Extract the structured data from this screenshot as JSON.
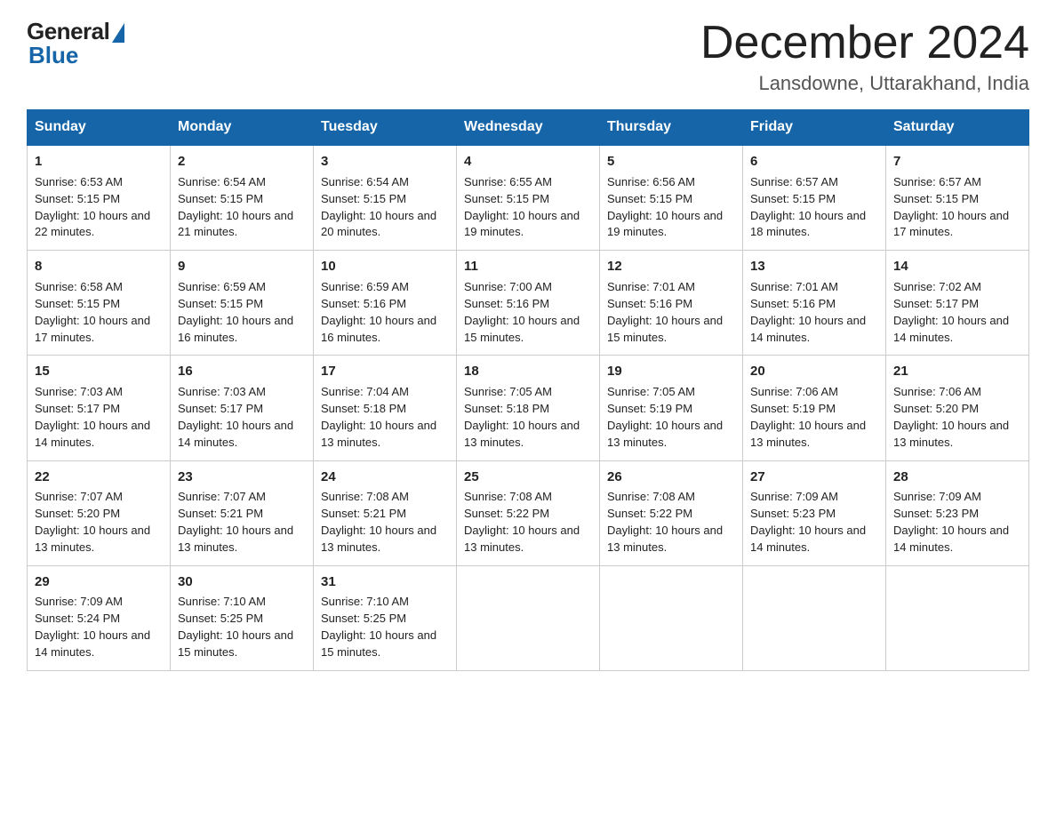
{
  "logo": {
    "general": "General",
    "blue": "Blue"
  },
  "title": "December 2024",
  "location": "Lansdowne, Uttarakhand, India",
  "weekdays": [
    "Sunday",
    "Monday",
    "Tuesday",
    "Wednesday",
    "Thursday",
    "Friday",
    "Saturday"
  ],
  "weeks": [
    [
      {
        "day": "1",
        "sunrise": "6:53 AM",
        "sunset": "5:15 PM",
        "daylight": "10 hours and 22 minutes."
      },
      {
        "day": "2",
        "sunrise": "6:54 AM",
        "sunset": "5:15 PM",
        "daylight": "10 hours and 21 minutes."
      },
      {
        "day": "3",
        "sunrise": "6:54 AM",
        "sunset": "5:15 PM",
        "daylight": "10 hours and 20 minutes."
      },
      {
        "day": "4",
        "sunrise": "6:55 AM",
        "sunset": "5:15 PM",
        "daylight": "10 hours and 19 minutes."
      },
      {
        "day": "5",
        "sunrise": "6:56 AM",
        "sunset": "5:15 PM",
        "daylight": "10 hours and 19 minutes."
      },
      {
        "day": "6",
        "sunrise": "6:57 AM",
        "sunset": "5:15 PM",
        "daylight": "10 hours and 18 minutes."
      },
      {
        "day": "7",
        "sunrise": "6:57 AM",
        "sunset": "5:15 PM",
        "daylight": "10 hours and 17 minutes."
      }
    ],
    [
      {
        "day": "8",
        "sunrise": "6:58 AM",
        "sunset": "5:15 PM",
        "daylight": "10 hours and 17 minutes."
      },
      {
        "day": "9",
        "sunrise": "6:59 AM",
        "sunset": "5:15 PM",
        "daylight": "10 hours and 16 minutes."
      },
      {
        "day": "10",
        "sunrise": "6:59 AM",
        "sunset": "5:16 PM",
        "daylight": "10 hours and 16 minutes."
      },
      {
        "day": "11",
        "sunrise": "7:00 AM",
        "sunset": "5:16 PM",
        "daylight": "10 hours and 15 minutes."
      },
      {
        "day": "12",
        "sunrise": "7:01 AM",
        "sunset": "5:16 PM",
        "daylight": "10 hours and 15 minutes."
      },
      {
        "day": "13",
        "sunrise": "7:01 AM",
        "sunset": "5:16 PM",
        "daylight": "10 hours and 14 minutes."
      },
      {
        "day": "14",
        "sunrise": "7:02 AM",
        "sunset": "5:17 PM",
        "daylight": "10 hours and 14 minutes."
      }
    ],
    [
      {
        "day": "15",
        "sunrise": "7:03 AM",
        "sunset": "5:17 PM",
        "daylight": "10 hours and 14 minutes."
      },
      {
        "day": "16",
        "sunrise": "7:03 AM",
        "sunset": "5:17 PM",
        "daylight": "10 hours and 14 minutes."
      },
      {
        "day": "17",
        "sunrise": "7:04 AM",
        "sunset": "5:18 PM",
        "daylight": "10 hours and 13 minutes."
      },
      {
        "day": "18",
        "sunrise": "7:05 AM",
        "sunset": "5:18 PM",
        "daylight": "10 hours and 13 minutes."
      },
      {
        "day": "19",
        "sunrise": "7:05 AM",
        "sunset": "5:19 PM",
        "daylight": "10 hours and 13 minutes."
      },
      {
        "day": "20",
        "sunrise": "7:06 AM",
        "sunset": "5:19 PM",
        "daylight": "10 hours and 13 minutes."
      },
      {
        "day": "21",
        "sunrise": "7:06 AM",
        "sunset": "5:20 PM",
        "daylight": "10 hours and 13 minutes."
      }
    ],
    [
      {
        "day": "22",
        "sunrise": "7:07 AM",
        "sunset": "5:20 PM",
        "daylight": "10 hours and 13 minutes."
      },
      {
        "day": "23",
        "sunrise": "7:07 AM",
        "sunset": "5:21 PM",
        "daylight": "10 hours and 13 minutes."
      },
      {
        "day": "24",
        "sunrise": "7:08 AM",
        "sunset": "5:21 PM",
        "daylight": "10 hours and 13 minutes."
      },
      {
        "day": "25",
        "sunrise": "7:08 AM",
        "sunset": "5:22 PM",
        "daylight": "10 hours and 13 minutes."
      },
      {
        "day": "26",
        "sunrise": "7:08 AM",
        "sunset": "5:22 PM",
        "daylight": "10 hours and 13 minutes."
      },
      {
        "day": "27",
        "sunrise": "7:09 AM",
        "sunset": "5:23 PM",
        "daylight": "10 hours and 14 minutes."
      },
      {
        "day": "28",
        "sunrise": "7:09 AM",
        "sunset": "5:23 PM",
        "daylight": "10 hours and 14 minutes."
      }
    ],
    [
      {
        "day": "29",
        "sunrise": "7:09 AM",
        "sunset": "5:24 PM",
        "daylight": "10 hours and 14 minutes."
      },
      {
        "day": "30",
        "sunrise": "7:10 AM",
        "sunset": "5:25 PM",
        "daylight": "10 hours and 15 minutes."
      },
      {
        "day": "31",
        "sunrise": "7:10 AM",
        "sunset": "5:25 PM",
        "daylight": "10 hours and 15 minutes."
      },
      null,
      null,
      null,
      null
    ]
  ]
}
